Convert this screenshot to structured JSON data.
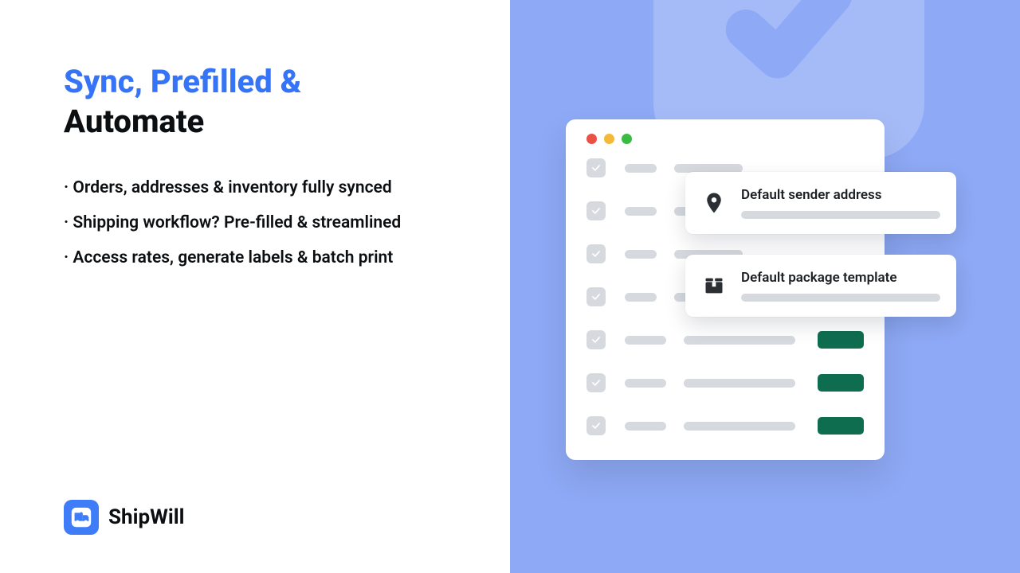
{
  "heading": {
    "line1": "Sync, Prefilled &",
    "line2": "Automate"
  },
  "bullets": [
    "Orders, addresses & inventory fully synced",
    "Shipping workflow? Pre-filled & streamlined",
    "Access rates, generate labels & batch print"
  ],
  "brand": {
    "name": "ShipWill"
  },
  "cards": [
    {
      "title": "Default sender address"
    },
    {
      "title": "Default package template"
    }
  ],
  "colors": {
    "accent": "#3574F6",
    "panel_bg": "#8EA9F5",
    "tag_green": "#0F6D4F"
  }
}
